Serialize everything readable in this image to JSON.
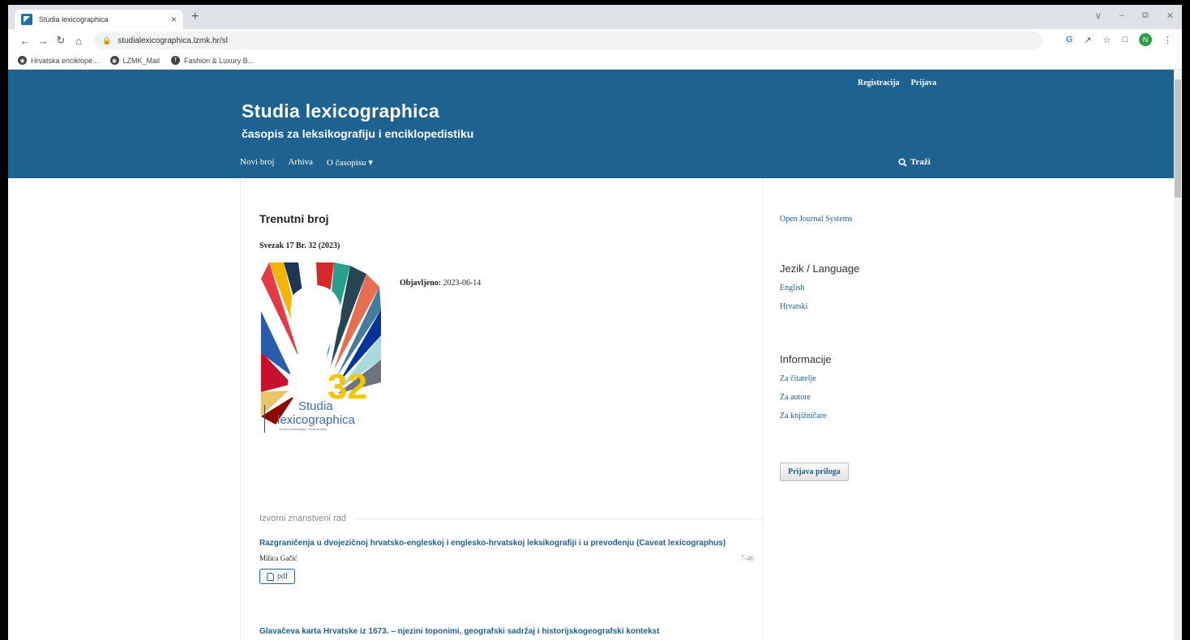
{
  "browser": {
    "tab_title": "Studia lexicographica",
    "tab_close": "×",
    "new_tab": "+",
    "url": "studialexicographica.lzmk.hr/sl",
    "bookmarks": [
      "Hrvatska enciklope...",
      "LZMK_Mail",
      "Fashion & Luxury B..."
    ],
    "profile_initial": "N"
  },
  "header": {
    "register": "Registracija",
    "login": "Prijava",
    "title": "Studia lexicographica",
    "subtitle": "časopis za leksikografiju i enciklopedistiku",
    "nav": [
      "Novi broj",
      "Arhiva",
      "O časopisu"
    ],
    "search": "Traži"
  },
  "main": {
    "heading": "Trenutni broj",
    "issue": "Svezak 17 Br. 32 (2023)",
    "published_label": "Objavljeno:",
    "published_date": "2023-06-14",
    "cover": {
      "number": "32",
      "line1": "Studia",
      "line2": "lexicographica",
      "line3": "časopis za leksikografiju i enciklopedistiku"
    },
    "section": "Izvorni znanstveni rad",
    "articles": [
      {
        "title": "Razgraničenja u dvojezičnoj hrvatsko-engleskoj i englesko-hrvatskoj leksikografiji i u prevođenju (Caveat lexicographus)",
        "author": "Milica Gačić",
        "pages": "7-46",
        "pdf": "pdf"
      },
      {
        "title": "Glavačeva karta Hrvatske iz 1673. – njezini toponimi, geografski sadržaj i historijskogeografski kontekst"
      }
    ]
  },
  "sidebar": {
    "ojs": "Open Journal Systems",
    "lang_heading": "Jezik / Language",
    "languages": [
      "English",
      "Hrvatski"
    ],
    "info_heading": "Informacije",
    "info_links": [
      "Za čitatelje",
      "Za autore",
      "Za knjižničare"
    ],
    "submit": "Prijava priloga"
  }
}
